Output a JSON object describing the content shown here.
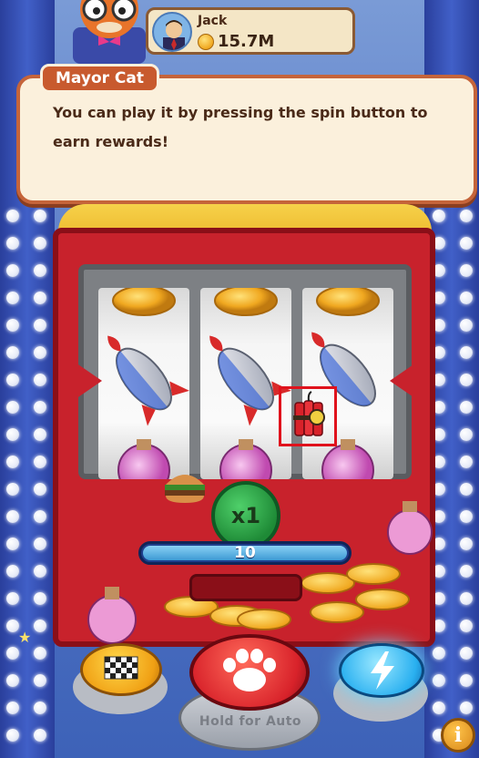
{
  "player": {
    "name": "Jack",
    "coins": "15.7M"
  },
  "dialog": {
    "speaker": "Mayor Cat",
    "message_line1": "You can play it by pressing the spin button to",
    "message_line2": "earn rewards!"
  },
  "reels": [
    {
      "top": "coin",
      "middle": "rocket",
      "bottom": "potion"
    },
    {
      "top": "coin",
      "middle": "rocket",
      "bottom": "potion"
    },
    {
      "top": "coin",
      "middle": "rocket",
      "bottom": "potion"
    }
  ],
  "highlighted_item": "dynamite-icon",
  "multiplier": "x1",
  "bet": "10",
  "buttons": {
    "spin_hint": "Hold for Auto",
    "info": "i"
  },
  "colors": {
    "machine_red": "#c8222c",
    "dialog_border": "#c5643a",
    "highlight": "#e0121c",
    "multiplier_green": "#2ab04a"
  }
}
